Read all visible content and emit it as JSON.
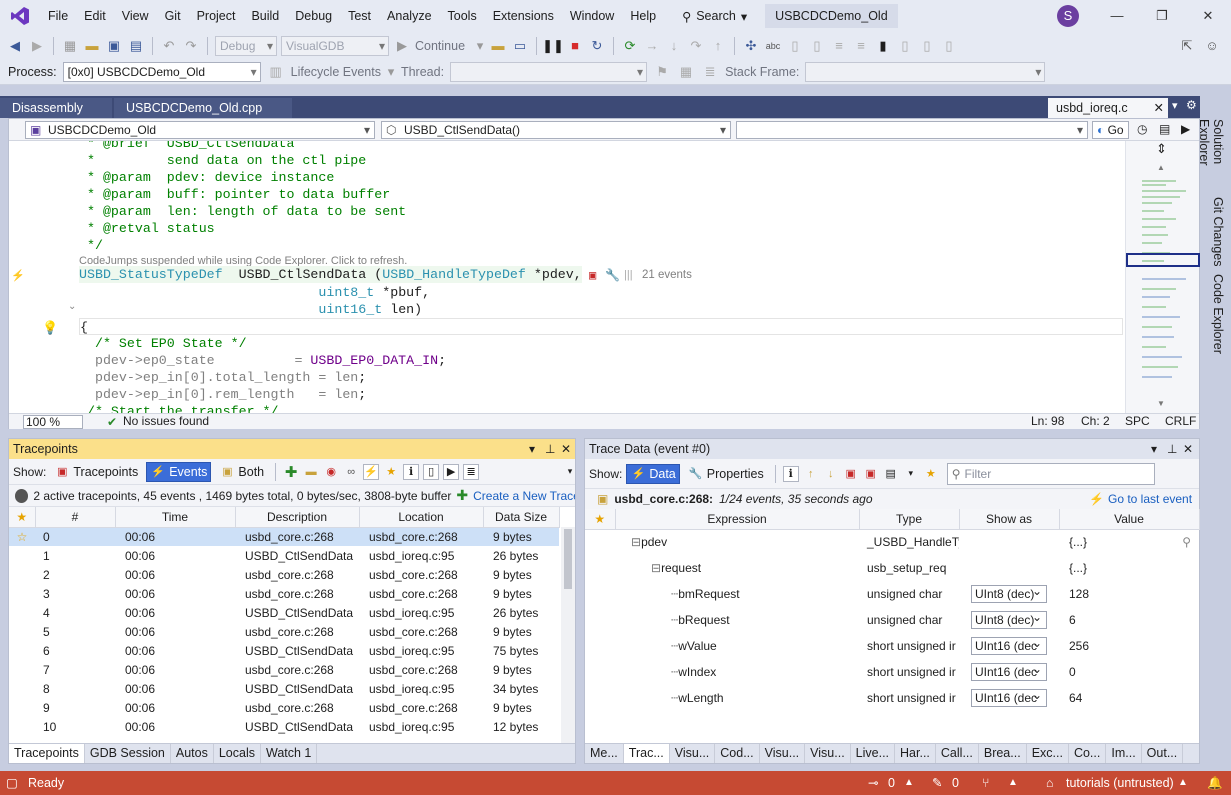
{
  "menu": {
    "items": [
      "File",
      "Edit",
      "View",
      "Git",
      "Project",
      "Build",
      "Debug",
      "Test",
      "Analyze",
      "Tools",
      "Extensions",
      "Window",
      "Help"
    ],
    "search_label": "Search",
    "solution_title": "USBCDCDemo_Old",
    "avatar_letter": "S"
  },
  "toolbar": {
    "config": "Debug",
    "platform": "VisualGDB",
    "continue_label": "Continue",
    "process_label": "Process:",
    "process_value": "[0x0] USBCDCDemo_Old",
    "lifecycle_label": "Lifecycle Events",
    "thread_label": "Thread:",
    "stackframe_label": "Stack Frame:"
  },
  "doctabs": {
    "tab1": "Disassembly",
    "tab2": "USBCDCDemo_Old.cpp",
    "active": "usbd_ioreq.c"
  },
  "editor": {
    "project_combo": "USBCDCDemo_Old",
    "func_combo": "USBD_CtlSendData()",
    "go_label": "Go",
    "codejumps_note": "CodeJumps suspended while using Code Explorer. Click to refresh.",
    "events_badge": "21 events",
    "zoom": "100 %",
    "issues": "No issues found",
    "ln": "Ln: 98",
    "ch": "Ch: 2",
    "spc": "SPC",
    "crlf": "CRLF",
    "lines": {
      "l0a": " * @brief  ",
      "l0b": "USBD_CtlSendData",
      "l1": " *         send data on the ctl pipe",
      "l2": " * @param  pdev: device instance",
      "l3": " * @param  buff: pointer to data buffer",
      "l4": " * @param  len: length of data to be sent",
      "l5": " * @retval status",
      "l6": " */",
      "sig_type": "USBD_StatusTypeDef",
      "sig_fn": "USBD_CtlSendData",
      "sig_open": " (",
      "sig_ptype": "USBD_HandleTypeDef",
      "sig_p": " *pdev,",
      "p2_type": "uint8_t",
      "p2": " *pbuf,",
      "p3_type": "uint16_t",
      "p3": " len)",
      "brace": "{",
      "c1": "  /* Set EP0 State */",
      "s1a": "  pdev->ep0_state          = ",
      "s1b": "USBD_EP0_DATA_IN",
      "s1c": ";",
      "s2a": "  pdev->ep_in[0].total_length = ",
      "s2b": "len",
      "s2c": ";",
      "s3a": "  pdev->ep_in[0].rem_length   = ",
      "s3b": "len",
      "s3c": ";",
      "c2": " /* Start the transfer */"
    }
  },
  "sidetabs": [
    "Solution Explorer",
    "Git Changes",
    "Code Explorer"
  ],
  "tracepoints": {
    "title": "Tracepoints",
    "show_label": "Show:",
    "btn_tracepoints": "Tracepoints",
    "btn_events": "Events",
    "btn_both": "Both",
    "summary": "2 active tracepoints, 45 events , 1469 bytes total, 0 bytes/sec, 3808-byte buffer",
    "create_link": "Create a New Trace",
    "columns": [
      "#",
      "Time",
      "Description",
      "Location",
      "Data Size"
    ],
    "rows": [
      [
        "0",
        "00:06",
        "usbd_core.c:268",
        "usbd_core.c:268",
        "9 bytes"
      ],
      [
        "1",
        "00:06",
        "USBD_CtlSendData",
        "usbd_ioreq.c:95",
        "26 bytes"
      ],
      [
        "2",
        "00:06",
        "usbd_core.c:268",
        "usbd_core.c:268",
        "9 bytes"
      ],
      [
        "3",
        "00:06",
        "usbd_core.c:268",
        "usbd_core.c:268",
        "9 bytes"
      ],
      [
        "4",
        "00:06",
        "USBD_CtlSendData",
        "usbd_ioreq.c:95",
        "26 bytes"
      ],
      [
        "5",
        "00:06",
        "usbd_core.c:268",
        "usbd_core.c:268",
        "9 bytes"
      ],
      [
        "6",
        "00:06",
        "USBD_CtlSendData",
        "usbd_ioreq.c:95",
        "75 bytes"
      ],
      [
        "7",
        "00:06",
        "usbd_core.c:268",
        "usbd_core.c:268",
        "9 bytes"
      ],
      [
        "8",
        "00:06",
        "USBD_CtlSendData",
        "usbd_ioreq.c:95",
        "34 bytes"
      ],
      [
        "9",
        "00:06",
        "usbd_core.c:268",
        "usbd_core.c:268",
        "9 bytes"
      ],
      [
        "10",
        "00:06",
        "USBD_CtlSendData",
        "usbd_ioreq.c:95",
        "12 bytes"
      ]
    ],
    "bottom_tabs": [
      "Tracepoints",
      "GDB Session",
      "Autos",
      "Locals",
      "Watch 1"
    ]
  },
  "tracedata": {
    "title": "Trace Data (event #0)",
    "show_label": "Show:",
    "btn_data": "Data",
    "btn_properties": "Properties",
    "filter_placeholder": "Filter",
    "event_loc": "usbd_core.c:268:",
    "event_info": "1/24 events, 35 seconds ago",
    "goto_last": "Go to last event",
    "columns": [
      "Expression",
      "Type",
      "Show as",
      "Value"
    ],
    "rows": [
      {
        "expr": "pdev",
        "type": "_USBD_HandleTy",
        "show": "",
        "value": "{...}"
      },
      {
        "expr": "request",
        "type": "usb_setup_req",
        "show": "",
        "value": "{...}"
      },
      {
        "expr": "bmRequest",
        "type": "unsigned char",
        "show": "UInt8 (dec)",
        "value": "128"
      },
      {
        "expr": "bRequest",
        "type": "unsigned char",
        "show": "UInt8 (dec)",
        "value": "6"
      },
      {
        "expr": "wValue",
        "type": "short unsigned ir",
        "show": "UInt16 (dec",
        "value": "256"
      },
      {
        "expr": "wIndex",
        "type": "short unsigned ir",
        "show": "UInt16 (dec",
        "value": "0"
      },
      {
        "expr": "wLength",
        "type": "short unsigned ir",
        "show": "UInt16 (dec",
        "value": "64"
      }
    ],
    "bottom_tabs": [
      "Me...",
      "Trac...",
      "Visu...",
      "Cod...",
      "Visu...",
      "Visu...",
      "Live...",
      "Har...",
      "Call...",
      "Brea...",
      "Exc...",
      "Co...",
      "Im...",
      "Out..."
    ]
  },
  "status": {
    "ready": "Ready",
    "up_count": "0",
    "edit_count": "0",
    "repo": "tutorials (untrusted)"
  },
  "colors": {
    "accent": "#3b6dd8",
    "status_bar": "#c64a33",
    "tab_strip": "#3d4a76",
    "panel_title_active": "#fbe08a"
  }
}
